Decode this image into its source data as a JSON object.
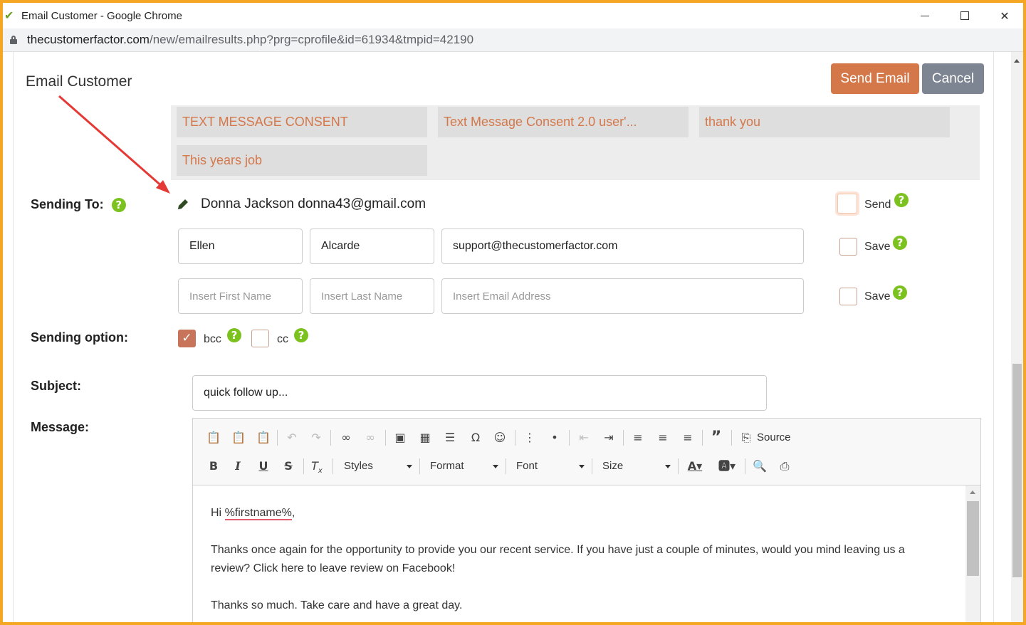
{
  "window": {
    "title": "Email Customer - Google Chrome",
    "url_domain": "thecustomerfactor.com",
    "url_path": "/new/emailresults.php?prg=cprofile&id=61934&tmpid=42190"
  },
  "header": {
    "title": "Email Customer",
    "send_label": "Send Email",
    "cancel_label": "Cancel"
  },
  "templates": [
    "TEXT MESSAGE CONSENT",
    "Text Message Consent 2.0 user'...",
    "thank you",
    "This years job"
  ],
  "sending_to": {
    "label": "Sending To:",
    "recipient": "Donna Jackson donna43@gmail.com",
    "send_label": "Send"
  },
  "extra_recipients": [
    {
      "first_name": "Ellen",
      "last_name": "Alcarde",
      "email": "support@thecustomerfactor.com",
      "save_label": "Save"
    },
    {
      "first_name_placeholder": "Insert First Name",
      "last_name_placeholder": "Insert Last Name",
      "email_placeholder": "Insert Email Address",
      "save_label": "Save"
    }
  ],
  "sending_option": {
    "label": "Sending option:",
    "bcc_label": "bcc",
    "bcc_checked": true,
    "cc_label": "cc",
    "cc_checked": false
  },
  "subject": {
    "label": "Subject:",
    "value": "quick follow up..."
  },
  "message": {
    "label": "Message:",
    "toolbar": {
      "source_label": "Source",
      "styles_label": "Styles",
      "format_label": "Format",
      "font_label": "Font",
      "size_label": "Size"
    },
    "greeting_prefix": "Hi ",
    "greeting_var": "%firstname%",
    "greeting_suffix": ",",
    "paragraph1": "Thanks once again for the opportunity to provide you our recent service. If you have just a couple of minutes, would you mind leaving us a review? Click here to leave review on Facebook!",
    "paragraph2": "Thanks so much. Take care and have a great day."
  },
  "colors": {
    "accent": "#d4784a",
    "help_icon": "#7cc21f",
    "cancel": "#7d8592",
    "annotation_arrow": "#e53935"
  }
}
